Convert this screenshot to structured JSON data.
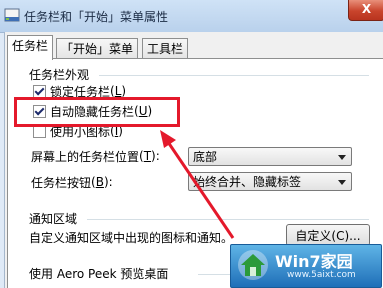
{
  "window": {
    "title": "任务栏和「开始」菜单属性",
    "close_label": "X"
  },
  "tabs": [
    {
      "label": "任务栏",
      "active": true
    },
    {
      "label": "「开始」菜单",
      "active": false
    },
    {
      "label": "工具栏",
      "active": false
    }
  ],
  "appearance": {
    "group_label": "任务栏外观",
    "lock": {
      "text": "锁定任务栏",
      "key": "L",
      "checked": true
    },
    "autohide": {
      "text": "自动隐藏任务栏",
      "key": "U",
      "checked": true
    },
    "small_icons": {
      "text": "使用小图标",
      "key": "I",
      "checked": false
    },
    "location": {
      "label_text": "屏幕上的任务栏位置",
      "key": "T",
      "value": "底部"
    },
    "buttons": {
      "label_text": "任务栏按钮",
      "key": "B",
      "value": "始终合并、隐藏标签"
    }
  },
  "notification": {
    "group_label": "通知区域",
    "description": "自定义通知区域中出现的图标和通知。",
    "customize_button": "自定义(C)..."
  },
  "aero": {
    "group_label": "使用 Aero Peek 预览桌面"
  },
  "watermark": {
    "brand": "Win7家园",
    "url": "www.5aixt.com"
  },
  "colors": {
    "annotation_red": "#e4192b"
  }
}
